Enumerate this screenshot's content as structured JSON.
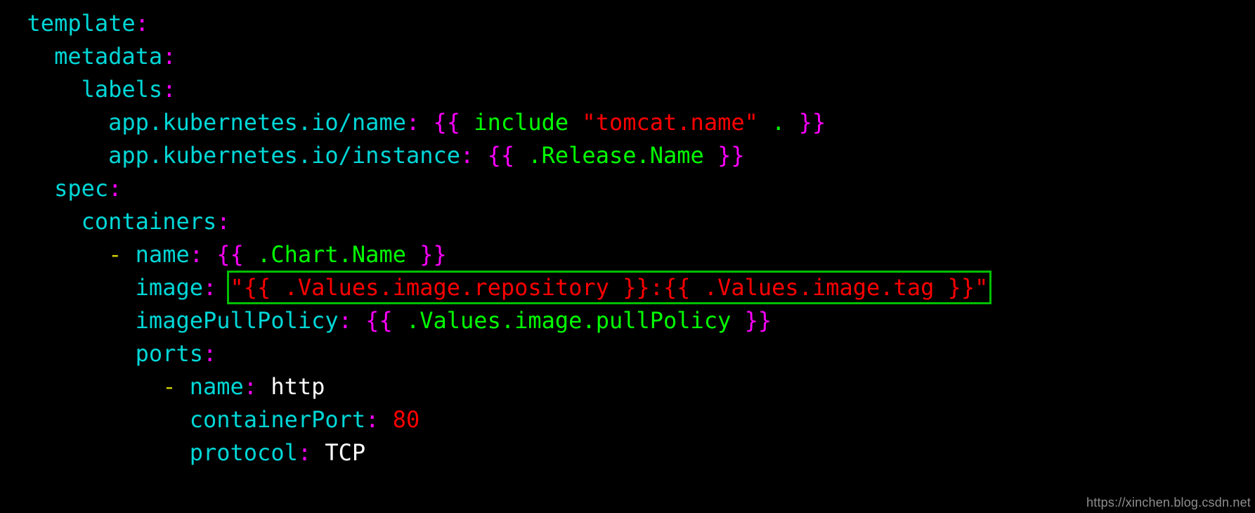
{
  "indent1": "  ",
  "indent2": "    ",
  "indent3": "      ",
  "indent4": "        ",
  "indent5": "          ",
  "indent6": "            ",
  "indent7": "              ",
  "keys": {
    "template": "template",
    "metadata": "metadata",
    "labels": "labels",
    "appName": "app.kubernetes.io/name",
    "appInstance": "app.kubernetes.io/instance",
    "spec": "spec",
    "containers": "containers",
    "name": "name",
    "image": "image",
    "imagePullPolicy": "imagePullPolicy",
    "ports": "ports",
    "containerPort": "containerPort",
    "protocol": "protocol"
  },
  "punct": {
    "colon": ":",
    "dash": "-",
    "ob": "{{",
    "cb": "}}",
    "dq": "\"",
    "dot": "."
  },
  "vals": {
    "include": " include ",
    "tomcatName": "\"tomcat.name\"",
    "dotSpace": " . ",
    "releaseName": " .Release.Name ",
    "chartName": " .Chart.Name ",
    "imageRepo": " .Values.image.repository ",
    "imageTag": " .Values.image.tag ",
    "pullPolicy": " .Values.image.pullPolicy ",
    "http": "http",
    "port80": "80",
    "tcp": "TCP"
  },
  "watermark": "https://xinchen.blog.csdn.net"
}
